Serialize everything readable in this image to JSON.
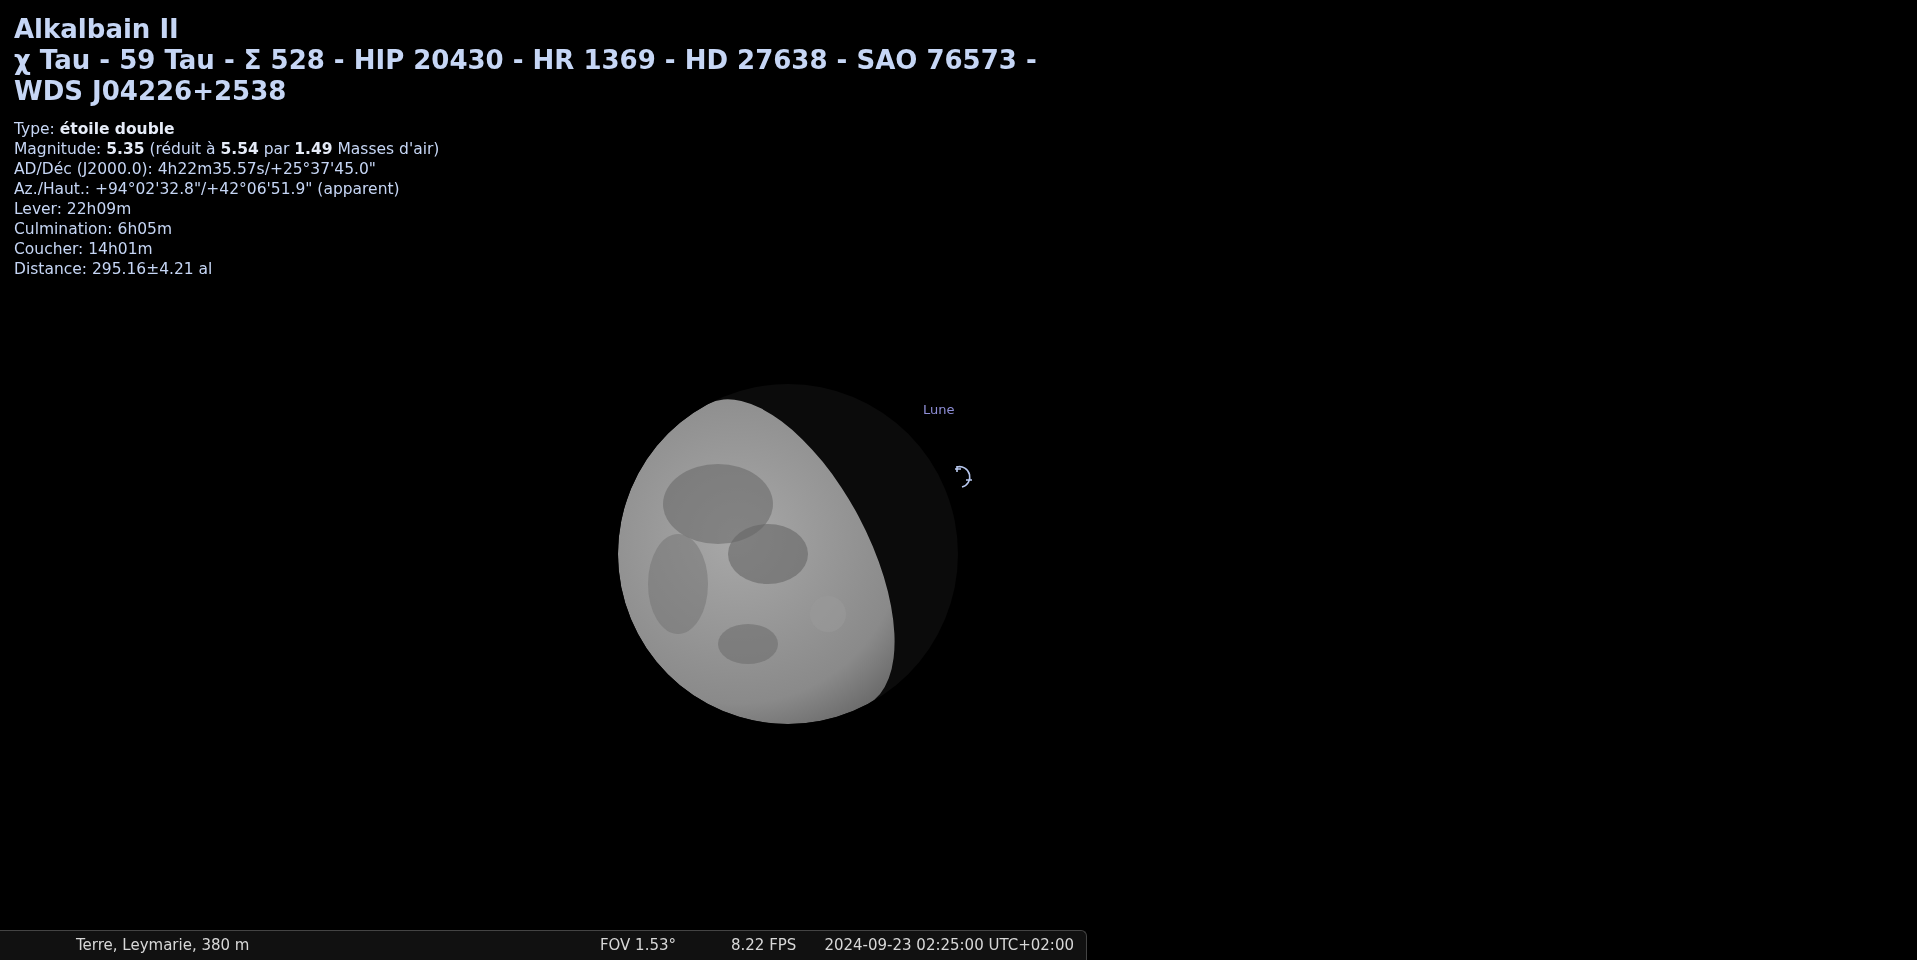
{
  "object": {
    "name": "Alkalbain II",
    "designations": [
      "χ Tau - 59 Tau - Σ 528 - HIP 20430 - HR 1369 - HD 27638 - SAO 76573 -",
      "WDS J04226+2538"
    ],
    "info": [
      "Type: **étoile double**",
      "Magnitude: **5.35** (réduit à **5.54** par **1.49** Masses d'air)",
      "AD/Déc (J2000.0): 4h22m35.57s/+25°37'45.0\"",
      "Az./Haut.: +94°02'32.8\"/+42°06'51.9\" (apparent)",
      "Lever: 22h09m",
      "Culmination: 6h05m",
      "Coucher: 14h01m",
      "Distance: 295.16±4.21 al"
    ]
  },
  "sky": {
    "moon_label": "Lune"
  },
  "status_bar": {
    "location": "Terre, Leymarie, 380 m",
    "fov": "FOV 1.53°",
    "fps": "8.22 FPS",
    "datetime": "2024-09-23 02:25:00 UTC+02:00"
  }
}
